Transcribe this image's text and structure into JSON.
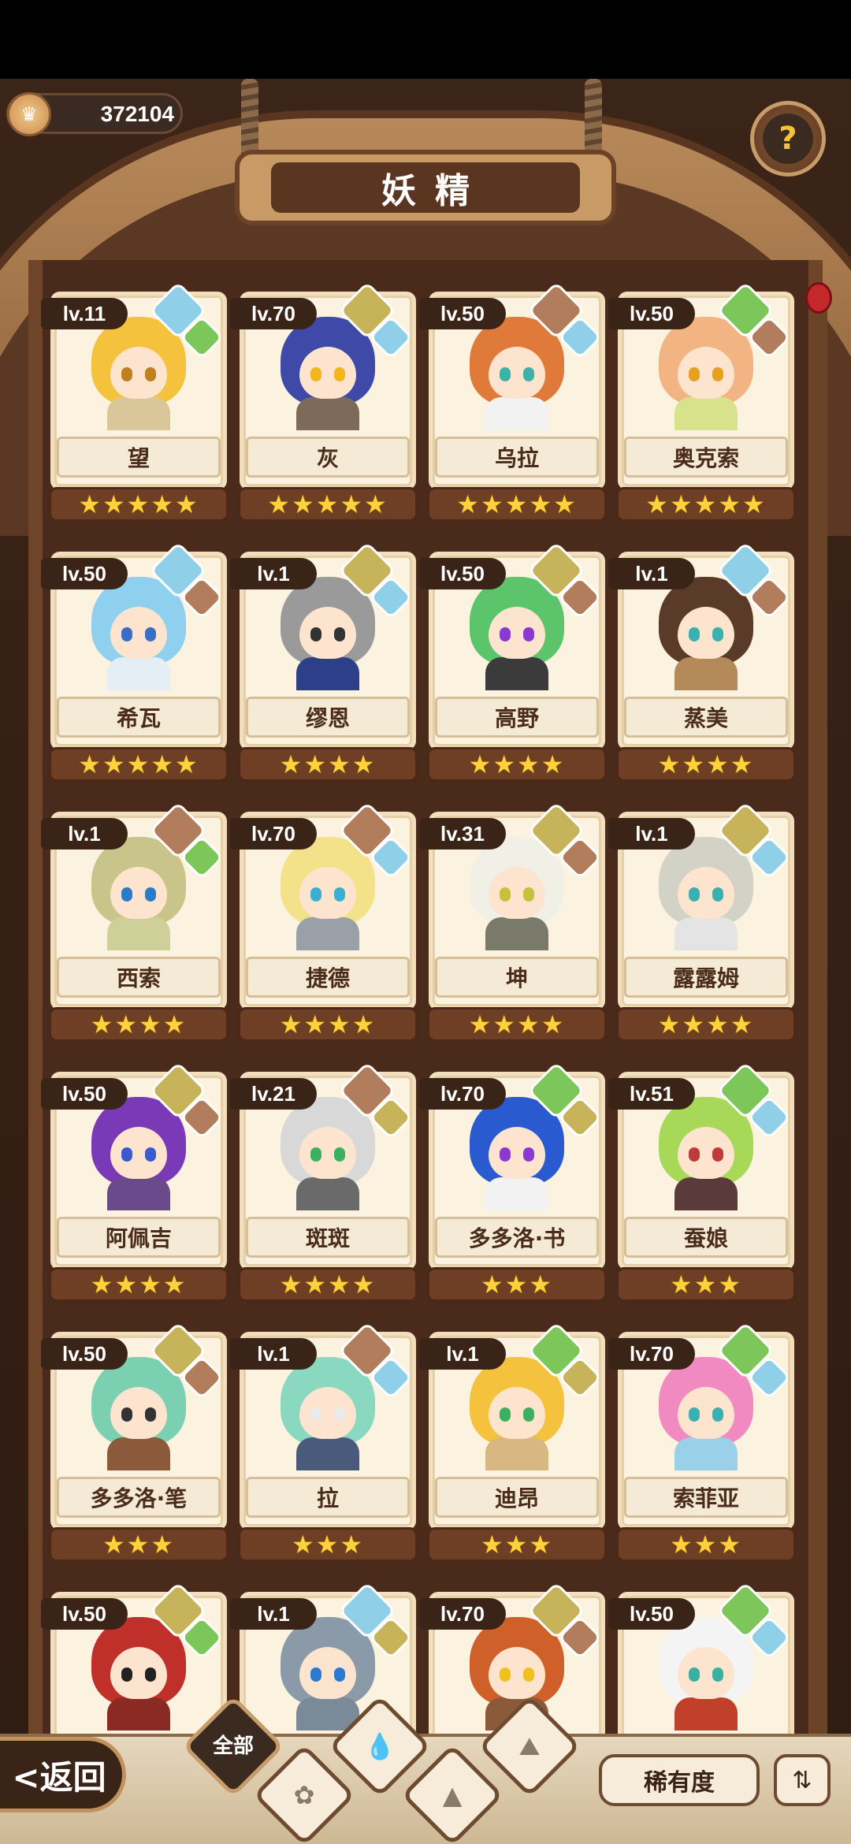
{
  "currency": {
    "value": "372104",
    "icon": "crown-coin-icon"
  },
  "title": "妖精",
  "help_icon": "question-sprout-icon",
  "back_label": "<返回",
  "filters": {
    "all_label": "全部",
    "icons": [
      "sprout-icon",
      "water-drop-icon",
      "mountain-icon",
      "volcano-icon"
    ]
  },
  "rarity_label": "稀有度",
  "sort_icon": "sort-icon",
  "star_char": "★",
  "elements_colors": {
    "water": "#8fd0e8",
    "earth": "#c7b35a",
    "fire": "#b27d5d",
    "wood": "#7cc65a"
  },
  "cards": [
    {
      "level": "lv.11",
      "name": "望",
      "stars": 5,
      "hair": "#f4c23c",
      "eyes": "#c08020",
      "outfit": "#d9c79a",
      "elems": [
        "water",
        "wood"
      ]
    },
    {
      "level": "lv.70",
      "name": "灰",
      "stars": 5,
      "hair": "#3f4aa8",
      "eyes": "#f2b51e",
      "outfit": "#7e6a58",
      "elems": [
        "earth",
        "water"
      ]
    },
    {
      "level": "lv.50",
      "name": "乌拉",
      "stars": 5,
      "hair": "#e07a3a",
      "eyes": "#3cb2a8",
      "outfit": "#f2f2f2",
      "elems": [
        "fire",
        "water"
      ]
    },
    {
      "level": "lv.50",
      "name": "奥克索",
      "stars": 5,
      "hair": "#f2b482",
      "eyes": "#e6a21e",
      "outfit": "#d7e28a",
      "elems": [
        "wood",
        "fire"
      ]
    },
    {
      "level": "lv.50",
      "name": "希瓦",
      "stars": 5,
      "hair": "#8fd0ee",
      "eyes": "#3a6dc6",
      "outfit": "#e4eef4",
      "elems": [
        "water",
        "fire"
      ]
    },
    {
      "level": "lv.1",
      "name": "缪恩",
      "stars": 4,
      "hair": "#9a9a9a",
      "eyes": "#333333",
      "outfit": "#2c3f88",
      "elems": [
        "earth",
        "water"
      ]
    },
    {
      "level": "lv.50",
      "name": "高野",
      "stars": 4,
      "hair": "#5cc46a",
      "eyes": "#8a3ad0",
      "outfit": "#3b3b3b",
      "elems": [
        "earth",
        "fire"
      ]
    },
    {
      "level": "lv.1",
      "name": "蒸美",
      "stars": 4,
      "hair": "#5a3a28",
      "eyes": "#3ab0b0",
      "outfit": "#b48a5a",
      "elems": [
        "water",
        "fire"
      ]
    },
    {
      "level": "lv.1",
      "name": "西索",
      "stars": 4,
      "hair": "#c9c48a",
      "eyes": "#2a7bc8",
      "outfit": "#cfcf9a",
      "elems": [
        "fire",
        "wood"
      ]
    },
    {
      "level": "lv.70",
      "name": "捷德",
      "stars": 4,
      "hair": "#f4e28a",
      "eyes": "#3ab0d0",
      "outfit": "#9aa0a8",
      "elems": [
        "fire",
        "water"
      ]
    },
    {
      "level": "lv.31",
      "name": "坤",
      "stars": 4,
      "hair": "#f0f0e6",
      "eyes": "#c6c03a",
      "outfit": "#7a7a6a",
      "elems": [
        "earth",
        "fire"
      ]
    },
    {
      "level": "lv.1",
      "name": "露露姆",
      "stars": 4,
      "hair": "#d2d2c6",
      "eyes": "#3ab0b0",
      "outfit": "#e4e4e4",
      "elems": [
        "earth",
        "water"
      ]
    },
    {
      "level": "lv.50",
      "name": "阿佩吉",
      "stars": 4,
      "hair": "#7a3ab8",
      "eyes": "#3a5ad0",
      "outfit": "#6a4a8a",
      "elems": [
        "earth",
        "fire"
      ]
    },
    {
      "level": "lv.21",
      "name": "斑斑",
      "stars": 4,
      "hair": "#d8d8d8",
      "eyes": "#3ab060",
      "outfit": "#6a6a6a",
      "elems": [
        "fire",
        "earth"
      ]
    },
    {
      "level": "lv.70",
      "name": "多多洛·书",
      "stars": 3,
      "hair": "#2a5ad0",
      "eyes": "#8a3ad0",
      "outfit": "#f2f2f2",
      "elems": [
        "wood",
        "earth"
      ]
    },
    {
      "level": "lv.51",
      "name": "蚕娘",
      "stars": 3,
      "hair": "#a8d858",
      "eyes": "#c03a3a",
      "outfit": "#5a3a3a",
      "elems": [
        "wood",
        "water"
      ]
    },
    {
      "level": "lv.50",
      "name": "多多洛·笔",
      "stars": 3,
      "hair": "#7ad0b0",
      "eyes": "#333333",
      "outfit": "#8a5a3a",
      "elems": [
        "earth",
        "fire"
      ]
    },
    {
      "level": "lv.1",
      "name": "拉",
      "stars": 3,
      "hair": "#8ad8c0",
      "eyes": "#eaeaea",
      "outfit": "#4a5a7a",
      "elems": [
        "fire",
        "water"
      ]
    },
    {
      "level": "lv.1",
      "name": "迪昂",
      "stars": 3,
      "hair": "#f4c23c",
      "eyes": "#3ab060",
      "outfit": "#d8b880",
      "elems": [
        "wood",
        "earth"
      ]
    },
    {
      "level": "lv.70",
      "name": "索菲亚",
      "stars": 3,
      "hair": "#f08ac0",
      "eyes": "#3ab0b0",
      "outfit": "#9ad0e8",
      "elems": [
        "wood",
        "water"
      ]
    },
    {
      "level": "lv.50",
      "name": "",
      "stars": 0,
      "hair": "#c0302a",
      "eyes": "#222222",
      "outfit": "#8a2a22",
      "elems": [
        "earth",
        "wood"
      ]
    },
    {
      "level": "lv.1",
      "name": "",
      "stars": 0,
      "hair": "#8a9aa8",
      "eyes": "#2a7ad0",
      "outfit": "#7a8a98",
      "elems": [
        "water",
        "earth"
      ]
    },
    {
      "level": "lv.70",
      "name": "",
      "stars": 0,
      "hair": "#d0602a",
      "eyes": "#f0c020",
      "outfit": "#8a5a3a",
      "elems": [
        "earth",
        "fire"
      ]
    },
    {
      "level": "lv.50",
      "name": "",
      "stars": 0,
      "hair": "#f4f4f4",
      "eyes": "#3ab0a0",
      "outfit": "#c0402a",
      "elems": [
        "wood",
        "water"
      ]
    }
  ]
}
